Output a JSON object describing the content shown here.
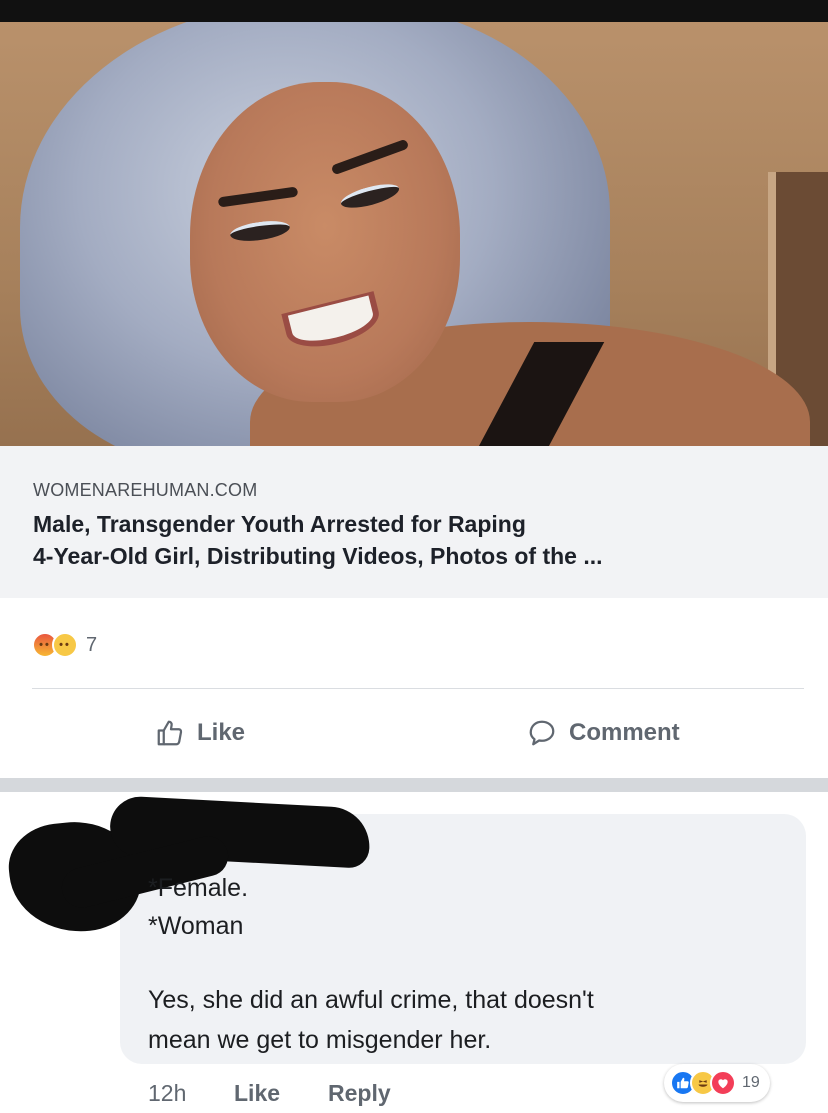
{
  "post": {
    "link": {
      "domain": "WOMENAREHUMAN.COM",
      "title_line1": "Male, Transgender Youth Arrested for Raping",
      "title_line2": "4-Year-Old Girl, Distributing Videos, Photos of the ..."
    },
    "reactions": {
      "icons": [
        "angry-emoji",
        "sad-emoji"
      ],
      "count": "7"
    },
    "actions": {
      "like_label": "Like",
      "comment_label": "Comment"
    }
  },
  "comment": {
    "lines": [
      "*Female.",
      "*Woman",
      "Yes, she did an awful crime, that doesn't",
      "mean we get to misgender her."
    ],
    "time": "12h",
    "like_label": "Like",
    "reply_label": "Reply",
    "reactions": {
      "icons": [
        "like-reaction",
        "haha-reaction",
        "love-reaction"
      ],
      "count": "19"
    }
  },
  "colors": {
    "facebook_blue": "#1877f2",
    "secondary_text": "#606770",
    "link_card_bg": "#f2f3f5"
  }
}
